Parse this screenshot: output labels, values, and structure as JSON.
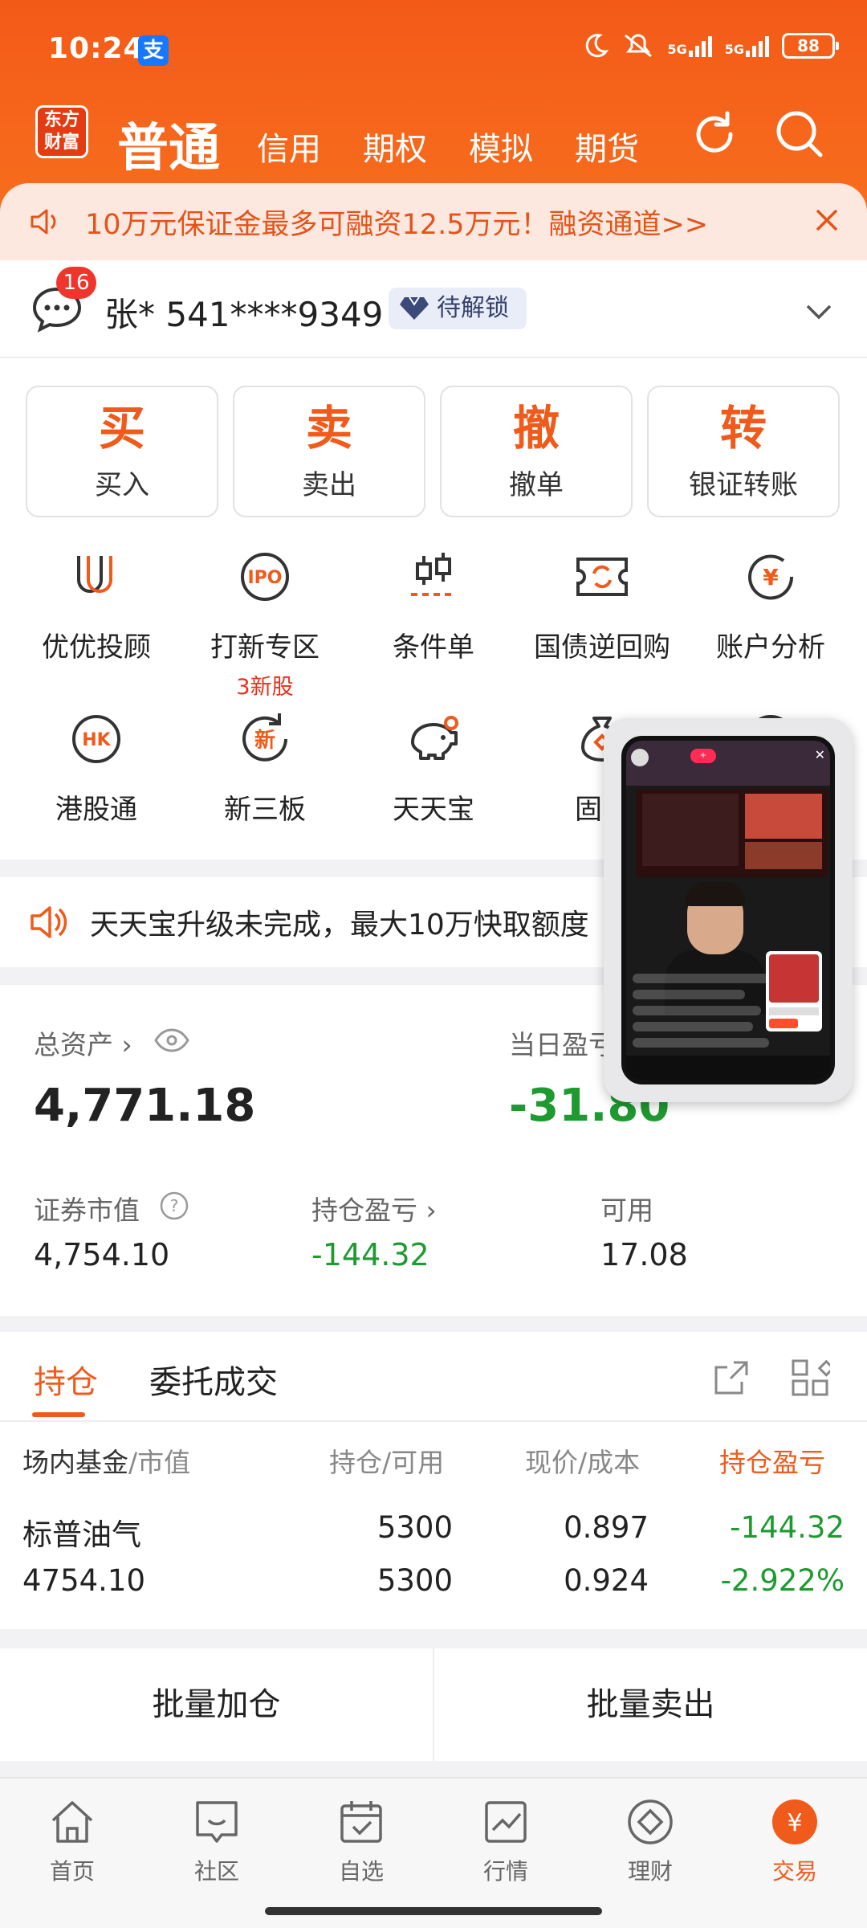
{
  "status_bar": {
    "time": "10:24",
    "alipay_glyph": "支",
    "signal1": "5G",
    "signal2": "5G",
    "battery": "88"
  },
  "brand": {
    "logo_line1": "东方",
    "logo_line2": "财富"
  },
  "nav_tabs": [
    {
      "label": "普通",
      "active": true
    },
    {
      "label": "信用"
    },
    {
      "label": "期权"
    },
    {
      "label": "模拟"
    },
    {
      "label": "期货"
    }
  ],
  "promo": {
    "text": "10万元保证金最多可融资12.5万元！融资通道>>"
  },
  "account": {
    "badge_count": "16",
    "name": "张* 541****9349",
    "vip_label": "待解锁"
  },
  "trade_buttons": [
    {
      "glyph": "买",
      "label": "买入"
    },
    {
      "glyph": "卖",
      "label": "卖出"
    },
    {
      "glyph": "撤",
      "label": "撤单"
    },
    {
      "glyph": "转",
      "label": "银证转账"
    }
  ],
  "grid_row1": [
    {
      "icon": "advisor-icon",
      "label": "优优投顾"
    },
    {
      "icon": "ipo-icon",
      "label": "打新专区",
      "sub": "3新股",
      "icon_text": "IPO"
    },
    {
      "icon": "condition-order-icon",
      "label": "条件单"
    },
    {
      "icon": "repo-icon",
      "label": "国债逆回购"
    },
    {
      "icon": "account-analysis-icon",
      "label": "账户分析",
      "icon_text": "¥"
    }
  ],
  "grid_row2": [
    {
      "icon": "hk-stock-icon",
      "label": "港股通",
      "icon_text": "HK"
    },
    {
      "icon": "new-third-board-icon",
      "label": "新三板",
      "icon_text": "新"
    },
    {
      "icon": "piggy-bank-icon",
      "label": "天天宝"
    },
    {
      "icon": "fixed-income-icon",
      "label": "固收"
    }
  ],
  "notice": {
    "text": "天天宝升级未完成，最大10万快取额度"
  },
  "assets": {
    "total_label": "总资产",
    "total_value": "4,771.18",
    "daily_pl_label": "当日盈亏",
    "daily_pl_value": "-31.80",
    "market_value_label": "证券市值",
    "market_value": "4,754.10",
    "position_pl_label": "持仓盈亏",
    "position_pl_value": "-144.32",
    "available_label": "可用",
    "available_value": "17.08"
  },
  "holdings": {
    "tabs": [
      "持仓",
      "委托成交"
    ],
    "headers": {
      "col1_main": "场内基金",
      "col1_sub": "/市值",
      "col2": "持仓/可用",
      "col3": "现价/成本",
      "col4": "持仓盈亏"
    },
    "rows": [
      {
        "name": "标普油气",
        "market_value": "4754.10",
        "position": "5300",
        "available": "5300",
        "price": "0.897",
        "cost": "0.924",
        "pl": "-144.32",
        "pl_pct": "-2.922%"
      }
    ]
  },
  "batch": {
    "add_label": "批量加仓",
    "sell_label": "批量卖出"
  },
  "bottom_nav": [
    {
      "icon": "home-icon",
      "label": "首页"
    },
    {
      "icon": "community-icon",
      "label": "社区"
    },
    {
      "icon": "watchlist-icon",
      "label": "自选"
    },
    {
      "icon": "market-icon",
      "label": "行情"
    },
    {
      "icon": "wealth-icon",
      "label": "理财"
    },
    {
      "icon": "trade-icon",
      "label": "交易",
      "active": true,
      "glyph": "¥"
    }
  ],
  "colors": {
    "brand_orange": "#f35a18",
    "loss_green": "#1e9a30",
    "accent_orange": "#f05a1a"
  }
}
